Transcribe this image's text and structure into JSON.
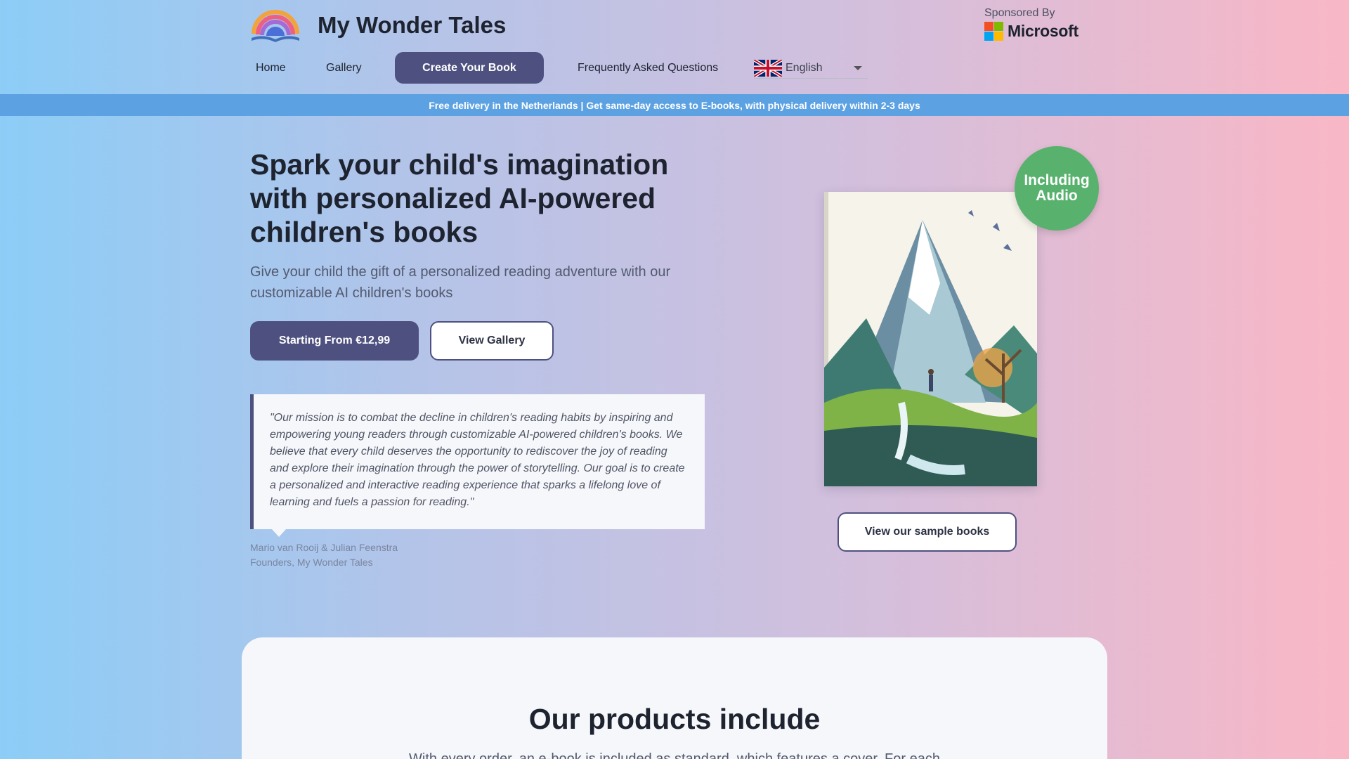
{
  "brand": {
    "name": "My Wonder Tales",
    "logo_icon": "rainbow-book-icon"
  },
  "sponsor": {
    "label": "Sponsored By",
    "company": "Microsoft",
    "colors": [
      "#f25022",
      "#7fba00",
      "#00a4ef",
      "#ffb900"
    ]
  },
  "nav": {
    "home": "Home",
    "gallery": "Gallery",
    "create": "Create Your Book",
    "faq": "Frequently Asked Questions",
    "language": "English",
    "language_icon": "uk-flag-icon"
  },
  "banner": {
    "text": "Free delivery in the Netherlands | Get same-day access to E-books, with physical delivery within 2-3 days"
  },
  "hero": {
    "title": "Spark your child's imagination with personalized AI-powered children's books",
    "subtitle": "Give your child the gift of a personalized reading adventure with our customizable AI children's books",
    "primary_button": "Starting From €12,99",
    "secondary_button": "View Gallery"
  },
  "quote": {
    "text": "\"Our mission is to combat the decline in children's reading habits by inspiring and empowering young readers through customizable AI-powered children's books. We believe that every child deserves the opportunity to rediscover the joy of reading and explore their imagination through the power of storytelling. Our goal is to create a personalized and interactive reading experience that sparks a lifelong love of learning and fuels a passion for reading.\"",
    "author": "Mario van Rooij & Julian Feenstra",
    "role": "Founders, My Wonder Tales"
  },
  "book": {
    "badge": "Including Audio",
    "samples_button": "View our sample books"
  },
  "products": {
    "title": "Our products include",
    "subtitle": "With every order, an e-book is included as standard, which features a cover. For each"
  },
  "colors": {
    "accent": "#4e5180",
    "banner": "#5ca1e1",
    "badge": "#58b26e"
  }
}
